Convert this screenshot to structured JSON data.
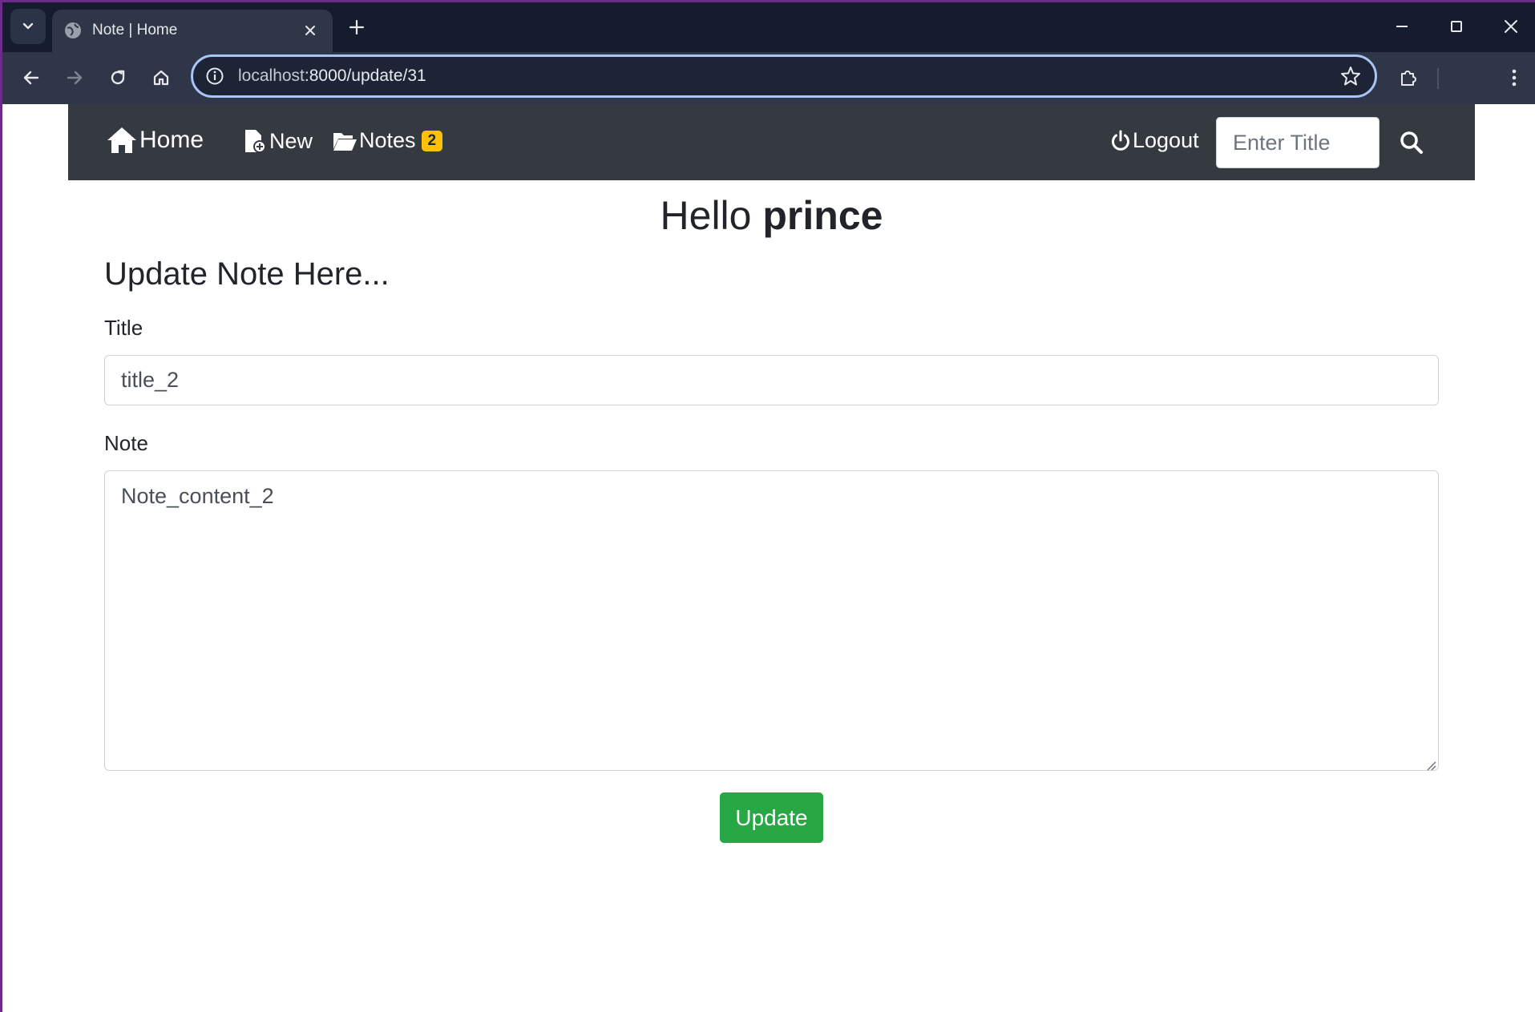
{
  "browser": {
    "tab_title": "Note | Home",
    "url_host": "localhost",
    "url_path": ":8000/update/31"
  },
  "navbar": {
    "home_label": "Home",
    "new_label": "New",
    "notes_label": "Notes",
    "notes_count": "2",
    "logout_label": "Logout",
    "search_placeholder": "Enter Title"
  },
  "greeting": {
    "prefix": "Hello",
    "username": "prince"
  },
  "form": {
    "heading": "Update Note Here...",
    "title_label": "Title",
    "title_value": "title_2",
    "note_label": "Note",
    "note_value": "Note_content_2",
    "submit_label": "Update"
  },
  "colors": {
    "navbar_bg": "#343a40",
    "badge_bg": "#ffc107",
    "button_bg": "#28a745"
  }
}
